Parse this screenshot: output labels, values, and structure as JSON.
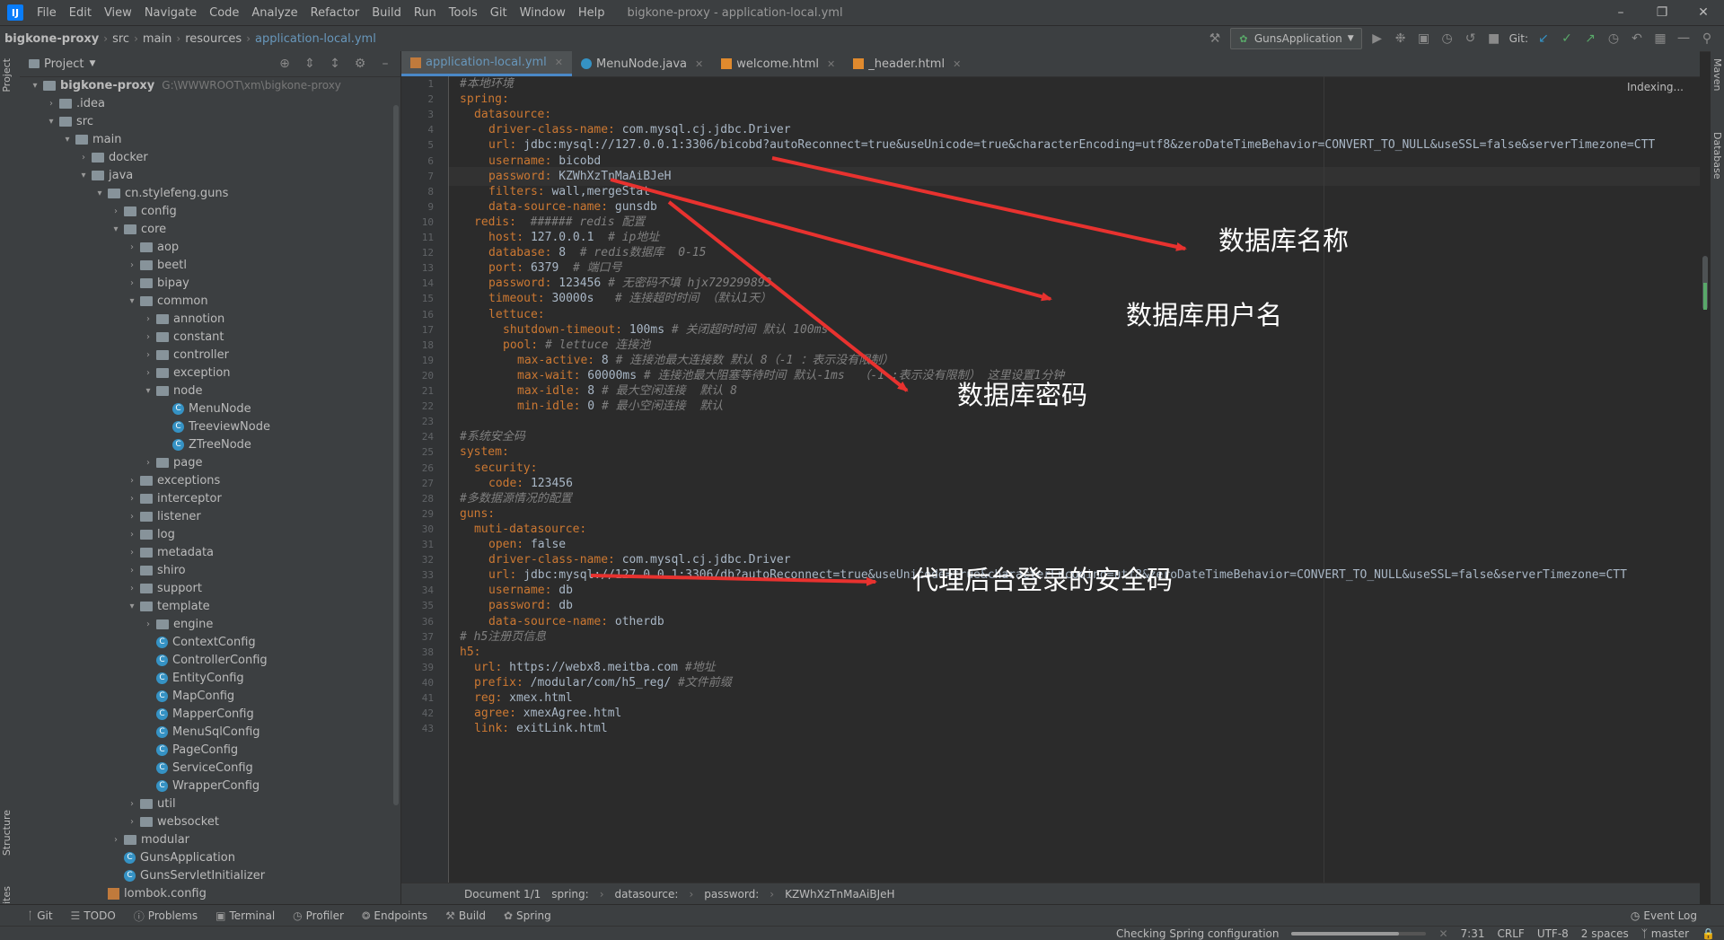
{
  "window": {
    "app_icon": "IJ",
    "menu": [
      "File",
      "Edit",
      "View",
      "Navigate",
      "Code",
      "Analyze",
      "Refactor",
      "Build",
      "Run",
      "Tools",
      "Git",
      "Window",
      "Help"
    ],
    "title": "bigkone-proxy - application-local.yml"
  },
  "navbar": {
    "crumbs": [
      "bigkone-proxy",
      "src",
      "main",
      "resources",
      "application-local.yml"
    ],
    "run_config": "GunsApplication",
    "git_label": "Git:"
  },
  "left_strip": {
    "project_tab": "Project",
    "structure_tab": "Structure",
    "favorites_tab": "Favorites"
  },
  "right_strip": {
    "maven_tab": "Maven",
    "database_tab": "Database"
  },
  "project_panel": {
    "title": "Project",
    "root_path": "G:\\WWWROOT\\xm\\bigkone-proxy",
    "tree": [
      {
        "label": "bigkone-proxy",
        "depth": 0,
        "kind": "root",
        "arrow": "v"
      },
      {
        "label": ".idea",
        "depth": 1,
        "kind": "folder",
        "arrow": ">"
      },
      {
        "label": "src",
        "depth": 1,
        "kind": "folder",
        "arrow": "v"
      },
      {
        "label": "main",
        "depth": 2,
        "kind": "folder",
        "arrow": "v"
      },
      {
        "label": "docker",
        "depth": 3,
        "kind": "folder",
        "arrow": ">"
      },
      {
        "label": "java",
        "depth": 3,
        "kind": "folder",
        "arrow": "v"
      },
      {
        "label": "cn.stylefeng.guns",
        "depth": 4,
        "kind": "folder",
        "arrow": "v"
      },
      {
        "label": "config",
        "depth": 5,
        "kind": "folder",
        "arrow": ">"
      },
      {
        "label": "core",
        "depth": 5,
        "kind": "folder",
        "arrow": "v"
      },
      {
        "label": "aop",
        "depth": 6,
        "kind": "folder",
        "arrow": ">"
      },
      {
        "label": "beetl",
        "depth": 6,
        "kind": "folder",
        "arrow": ">"
      },
      {
        "label": "bipay",
        "depth": 6,
        "kind": "folder",
        "arrow": ">"
      },
      {
        "label": "common",
        "depth": 6,
        "kind": "folder",
        "arrow": "v"
      },
      {
        "label": "annotion",
        "depth": 7,
        "kind": "folder",
        "arrow": ">"
      },
      {
        "label": "constant",
        "depth": 7,
        "kind": "folder",
        "arrow": ">"
      },
      {
        "label": "controller",
        "depth": 7,
        "kind": "folder",
        "arrow": ">"
      },
      {
        "label": "exception",
        "depth": 7,
        "kind": "folder",
        "arrow": ">"
      },
      {
        "label": "node",
        "depth": 7,
        "kind": "folder",
        "arrow": "v"
      },
      {
        "label": "MenuNode",
        "depth": 8,
        "kind": "class",
        "arrow": ""
      },
      {
        "label": "TreeviewNode",
        "depth": 8,
        "kind": "class",
        "arrow": ""
      },
      {
        "label": "ZTreeNode",
        "depth": 8,
        "kind": "class",
        "arrow": ""
      },
      {
        "label": "page",
        "depth": 7,
        "kind": "folder",
        "arrow": ">"
      },
      {
        "label": "exceptions",
        "depth": 6,
        "kind": "folder",
        "arrow": ">"
      },
      {
        "label": "interceptor",
        "depth": 6,
        "kind": "folder",
        "arrow": ">"
      },
      {
        "label": "listener",
        "depth": 6,
        "kind": "folder",
        "arrow": ">"
      },
      {
        "label": "log",
        "depth": 6,
        "kind": "folder",
        "arrow": ">"
      },
      {
        "label": "metadata",
        "depth": 6,
        "kind": "folder",
        "arrow": ">"
      },
      {
        "label": "shiro",
        "depth": 6,
        "kind": "folder",
        "arrow": ">"
      },
      {
        "label": "support",
        "depth": 6,
        "kind": "folder",
        "arrow": ">"
      },
      {
        "label": "template",
        "depth": 6,
        "kind": "folder",
        "arrow": "v"
      },
      {
        "label": "engine",
        "depth": 7,
        "kind": "folder",
        "arrow": ">"
      },
      {
        "label": "ContextConfig",
        "depth": 7,
        "kind": "class",
        "arrow": ""
      },
      {
        "label": "ControllerConfig",
        "depth": 7,
        "kind": "class",
        "arrow": ""
      },
      {
        "label": "EntityConfig",
        "depth": 7,
        "kind": "class",
        "arrow": ""
      },
      {
        "label": "MapConfig",
        "depth": 7,
        "kind": "class",
        "arrow": ""
      },
      {
        "label": "MapperConfig",
        "depth": 7,
        "kind": "class",
        "arrow": ""
      },
      {
        "label": "MenuSqlConfig",
        "depth": 7,
        "kind": "class",
        "arrow": ""
      },
      {
        "label": "PageConfig",
        "depth": 7,
        "kind": "class",
        "arrow": ""
      },
      {
        "label": "ServiceConfig",
        "depth": 7,
        "kind": "class",
        "arrow": ""
      },
      {
        "label": "WrapperConfig",
        "depth": 7,
        "kind": "class",
        "arrow": ""
      },
      {
        "label": "util",
        "depth": 6,
        "kind": "folder",
        "arrow": ">"
      },
      {
        "label": "websocket",
        "depth": 6,
        "kind": "folder",
        "arrow": ">"
      },
      {
        "label": "modular",
        "depth": 5,
        "kind": "folder",
        "arrow": ">"
      },
      {
        "label": "GunsApplication",
        "depth": 5,
        "kind": "class",
        "arrow": ""
      },
      {
        "label": "GunsServletInitializer",
        "depth": 5,
        "kind": "class",
        "arrow": ""
      },
      {
        "label": "lombok.config",
        "depth": 4,
        "kind": "file",
        "arrow": ""
      }
    ]
  },
  "editor": {
    "tabs": [
      {
        "label": "application-local.yml",
        "icon": "yaml",
        "active": true
      },
      {
        "label": "MenuNode.java",
        "icon": "java",
        "active": false
      },
      {
        "label": "welcome.html",
        "icon": "html",
        "active": false
      },
      {
        "label": "_header.html",
        "icon": "html",
        "active": false
      }
    ],
    "indexing": "Indexing...",
    "lines": [
      {
        "n": 1,
        "i": 0,
        "k": "",
        "v": "",
        "c": "#本地环境"
      },
      {
        "n": 2,
        "i": 0,
        "k": "spring:",
        "v": "",
        "c": ""
      },
      {
        "n": 3,
        "i": 1,
        "k": "datasource:",
        "v": "",
        "c": ""
      },
      {
        "n": 4,
        "i": 2,
        "k": "driver-class-name:",
        "v": " com.mysql.cj.jdbc.Driver",
        "c": ""
      },
      {
        "n": 5,
        "i": 2,
        "k": "url:",
        "v": " jdbc:mysql://127.0.0.1:3306/bicobd?autoReconnect=true&useUnicode=true&characterEncoding=utf8&zeroDateTimeBehavior=CONVERT_TO_NULL&useSSL=false&serverTimezone=CTT",
        "c": ""
      },
      {
        "n": 6,
        "i": 2,
        "k": "username:",
        "v": " bicobd",
        "c": ""
      },
      {
        "n": 7,
        "i": 2,
        "k": "password:",
        "v": " KZWhXzTnMaAiBJeH",
        "c": ""
      },
      {
        "n": 8,
        "i": 2,
        "k": "filters:",
        "v": " wall,mergeStat",
        "c": ""
      },
      {
        "n": 9,
        "i": 2,
        "k": "data-source-name:",
        "v": " gunsdb",
        "c": ""
      },
      {
        "n": 10,
        "i": 1,
        "k": "redis:",
        "v": "  ",
        "c": "###### redis 配置"
      },
      {
        "n": 11,
        "i": 2,
        "k": "host:",
        "v": " 127.0.0.1  ",
        "c": "# ip地址"
      },
      {
        "n": 12,
        "i": 2,
        "k": "database:",
        "v": " 8  ",
        "c": "# redis数据库  0-15"
      },
      {
        "n": 13,
        "i": 2,
        "k": "port:",
        "v": " 6379  ",
        "c": "# 端口号"
      },
      {
        "n": 14,
        "i": 2,
        "k": "password:",
        "v": " 123456 ",
        "c": "# 无密码不填 hjx729299893"
      },
      {
        "n": 15,
        "i": 2,
        "k": "timeout:",
        "v": " 30000s   ",
        "c": "# 连接超时时间 （默认1天）"
      },
      {
        "n": 16,
        "i": 2,
        "k": "lettuce:",
        "v": "",
        "c": ""
      },
      {
        "n": 17,
        "i": 3,
        "k": "shutdown-timeout:",
        "v": " 100ms ",
        "c": "# 关闭超时时间 默认 100ms"
      },
      {
        "n": 18,
        "i": 3,
        "k": "pool:",
        "v": " ",
        "c": "# lettuce 连接池"
      },
      {
        "n": 19,
        "i": 4,
        "k": "max-active:",
        "v": " 8 ",
        "c": "# 连接池最大连接数 默认 8（-1 ：表示没有限制）"
      },
      {
        "n": 20,
        "i": 4,
        "k": "max-wait:",
        "v": " 60000ms ",
        "c": "# 连接池最大阻塞等待时间 默认-1ms  （-1 :表示没有限制） 这里设置1分钟"
      },
      {
        "n": 21,
        "i": 4,
        "k": "max-idle:",
        "v": " 8 ",
        "c": "# 最大空闲连接  默认 8"
      },
      {
        "n": 22,
        "i": 4,
        "k": "min-idle:",
        "v": " 0 ",
        "c": "# 最小空闲连接  默认"
      },
      {
        "n": 23,
        "i": 0,
        "k": "",
        "v": "",
        "c": ""
      },
      {
        "n": 24,
        "i": 0,
        "k": "",
        "v": "",
        "c": "#系统安全码"
      },
      {
        "n": 25,
        "i": 0,
        "k": "system:",
        "v": "",
        "c": ""
      },
      {
        "n": 26,
        "i": 1,
        "k": "security:",
        "v": "",
        "c": ""
      },
      {
        "n": 27,
        "i": 2,
        "k": "code:",
        "v": " 123456",
        "c": ""
      },
      {
        "n": 28,
        "i": 0,
        "k": "",
        "v": "",
        "c": "#多数据源情况的配置"
      },
      {
        "n": 29,
        "i": 0,
        "k": "guns:",
        "v": "",
        "c": ""
      },
      {
        "n": 30,
        "i": 1,
        "k": "muti-datasource:",
        "v": "",
        "c": ""
      },
      {
        "n": 31,
        "i": 2,
        "k": "open:",
        "v": " false",
        "c": ""
      },
      {
        "n": 32,
        "i": 2,
        "k": "driver-class-name:",
        "v": " com.mysql.cj.jdbc.Driver",
        "c": ""
      },
      {
        "n": 33,
        "i": 2,
        "k": "url:",
        "v": " jdbc:mysql://127.0.0.1:3306/db?autoReconnect=true&useUnicode=true&characterEncoding=utf8&zeroDateTimeBehavior=CONVERT_TO_NULL&useSSL=false&serverTimezone=CTT",
        "c": ""
      },
      {
        "n": 34,
        "i": 2,
        "k": "username:",
        "v": " db",
        "c": ""
      },
      {
        "n": 35,
        "i": 2,
        "k": "password:",
        "v": " db",
        "c": ""
      },
      {
        "n": 36,
        "i": 2,
        "k": "data-source-name:",
        "v": " otherdb",
        "c": ""
      },
      {
        "n": 37,
        "i": 0,
        "k": "",
        "v": "",
        "c": "# h5注册页信息"
      },
      {
        "n": 38,
        "i": 0,
        "k": "h5:",
        "v": "",
        "c": ""
      },
      {
        "n": 39,
        "i": 1,
        "k": "url:",
        "v": " https://webx8.meitba.com ",
        "c": "#地址"
      },
      {
        "n": 40,
        "i": 1,
        "k": "prefix:",
        "v": " /modular/com/h5_reg/ ",
        "c": "#文件前缀"
      },
      {
        "n": 41,
        "i": 1,
        "k": "reg:",
        "v": " xmex.html",
        "c": ""
      },
      {
        "n": 42,
        "i": 1,
        "k": "agree:",
        "v": " xmexAgree.html",
        "c": ""
      },
      {
        "n": 43,
        "i": 1,
        "k": "link:",
        "v": " exitLink.html",
        "c": ""
      }
    ],
    "breadcrumb": [
      "Document 1/1",
      "spring:",
      "datasource:",
      "password:",
      "KZWhXzTnMaAiBJeH"
    ]
  },
  "annotations": {
    "db_name": "数据库名称",
    "db_user": "数据库用户名",
    "db_password": "数据库密码",
    "security_code": "代理后台登录的安全码",
    "arrow_color": "#e8322f"
  },
  "bottom_tools": [
    "Git",
    "TODO",
    "Problems",
    "Terminal",
    "Profiler",
    "Endpoints",
    "Build",
    "Spring"
  ],
  "event_log": "Event Log",
  "status": {
    "task": "Checking Spring configuration",
    "progress": 0.8,
    "position": "7:31",
    "line_sep": "CRLF",
    "encoding": "UTF-8",
    "indent": "2 spaces",
    "branch": "master"
  }
}
